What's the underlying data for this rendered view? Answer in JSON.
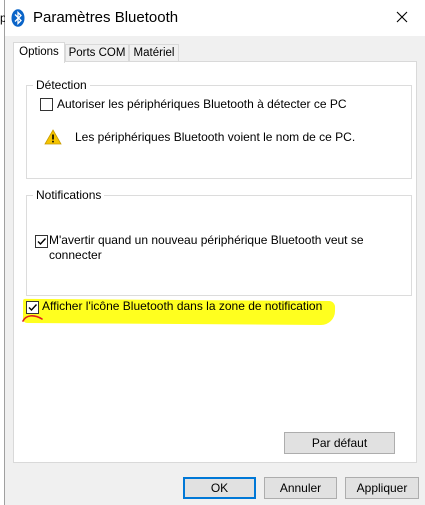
{
  "window": {
    "title": "Paramètres Bluetooth",
    "stray_char": "p"
  },
  "icons": {
    "title_icon": "bluetooth-icon",
    "close": "close-icon",
    "warning": "warning-icon"
  },
  "tabs": [
    {
      "label": "Options",
      "active": true
    },
    {
      "label": "Ports COM",
      "active": false
    },
    {
      "label": "Matériel",
      "active": false
    }
  ],
  "detection": {
    "legend": "Détection",
    "checkbox_label": "Autoriser les périphériques Bluetooth à détecter ce PC",
    "checked": false,
    "warning_text": "Les périphériques Bluetooth voient le nom de ce PC."
  },
  "notifications": {
    "legend": "Notifications",
    "checkbox_label_line1": "M'avertir quand un nouveau périphérique Bluetooth veut se",
    "checkbox_label_line2": "connecter",
    "checked": true
  },
  "tray_icon": {
    "checkbox_label": "Afficher l'icône Bluetooth dans la zone de notification",
    "checked": true
  },
  "buttons": {
    "defaults": "Par défaut",
    "ok": "OK",
    "cancel": "Annuler",
    "apply": "Appliquer"
  },
  "colors": {
    "highlight": "#ffff1f",
    "accent": "#0078d7",
    "annotation": "#e0201b",
    "warning": "#f5c400"
  }
}
